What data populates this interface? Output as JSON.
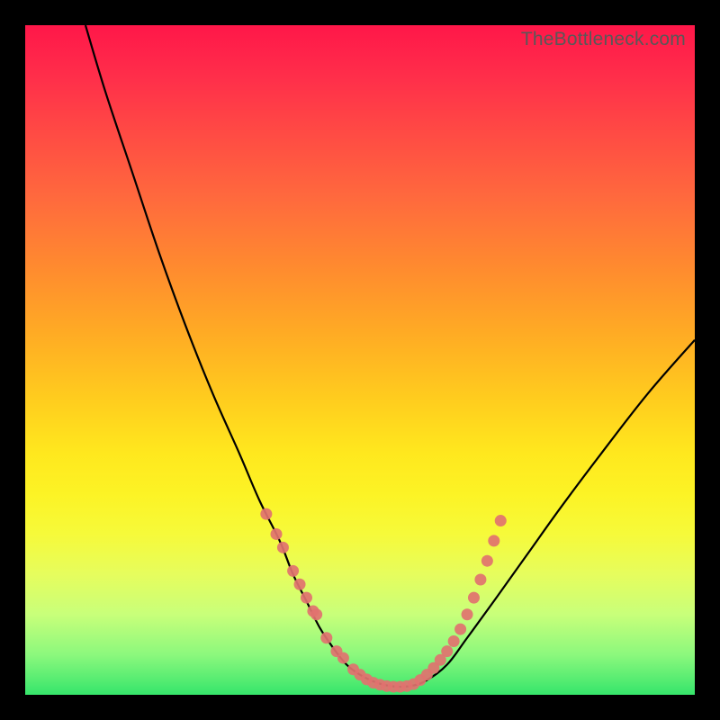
{
  "watermark": "TheBottleneck.com",
  "chart_data": {
    "type": "line",
    "title": "",
    "xlabel": "",
    "ylabel": "",
    "xlim": [
      0,
      100
    ],
    "ylim": [
      0,
      100
    ],
    "grid": false,
    "legend": false,
    "series": [
      {
        "name": "curve",
        "stroke": "#000000",
        "x": [
          9,
          12,
          16,
          20,
          24,
          28,
          32,
          35,
          38,
          40,
          42,
          44,
          46,
          48,
          50,
          52,
          54,
          56,
          58,
          60,
          63,
          66,
          70,
          75,
          80,
          86,
          93,
          100
        ],
        "y": [
          100,
          90,
          78,
          66,
          55,
          45,
          36,
          29,
          23,
          18,
          14,
          10,
          7,
          4.5,
          3,
          2,
          1.4,
          1.2,
          1.4,
          2.2,
          4.5,
          8.5,
          14,
          21,
          28,
          36,
          45,
          53
        ]
      },
      {
        "name": "left-dots",
        "type": "scatter",
        "stroke": "#e1726f",
        "x": [
          36,
          37.5,
          38.5,
          40,
          41,
          42,
          43,
          43.5,
          45,
          46.5,
          47.5,
          49,
          50,
          51,
          52,
          53,
          54,
          55,
          56,
          57
        ],
        "y": [
          27,
          24,
          22,
          18.5,
          16.5,
          14.5,
          12.5,
          12,
          8.5,
          6.5,
          5.5,
          3.8,
          3,
          2.3,
          1.8,
          1.5,
          1.3,
          1.2,
          1.2,
          1.3
        ]
      },
      {
        "name": "right-dots",
        "type": "scatter",
        "stroke": "#e1726f",
        "x": [
          58,
          59,
          60,
          61,
          62,
          63,
          64,
          65,
          66,
          67,
          68
        ],
        "y": [
          1.6,
          2.2,
          3,
          4,
          5.2,
          6.5,
          8,
          9.8,
          12,
          14.5,
          17.2
        ]
      },
      {
        "name": "right-dots-upper",
        "type": "scatter",
        "stroke": "#e1726f",
        "x": [
          69,
          70,
          71
        ],
        "y": [
          20,
          23,
          26
        ]
      }
    ]
  }
}
